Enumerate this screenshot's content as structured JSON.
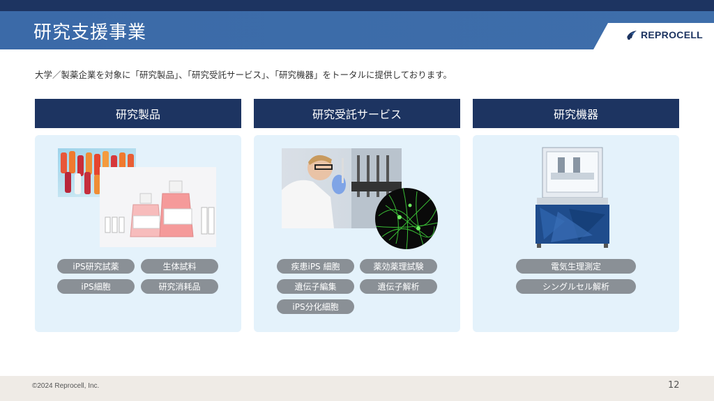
{
  "header": {
    "title": "研究支援事業",
    "logo_text": "REPROCELL",
    "logo_icon": "reprocell-bird-logo"
  },
  "intro": "大学／製薬企業を対象に「研究製品」、「研究受託サービス」、「研究機器」をトータルに提供しております。",
  "columns": [
    {
      "title": "研究製品",
      "tags": [
        "iPS研究試薬",
        "生体試料",
        "iPS細胞",
        "研究消耗品"
      ]
    },
    {
      "title": "研究受託サービス",
      "tags": [
        "疾患iPS 細胞",
        "薬効薬理試験",
        "遺伝子編集",
        "遺伝子解析",
        "iPS分化細胞"
      ]
    },
    {
      "title": "研究機器",
      "tags": [
        "電気生理測定",
        "シングルセル解析"
      ]
    }
  ],
  "footer": {
    "copyright": "©2024 Reprocell, Inc.",
    "page_number": "12"
  },
  "colors": {
    "navy": "#1d3461",
    "title_blue": "#3b6aa8",
    "panel_bg": "#e4f2fb",
    "pill_gray": "#8a9096"
  }
}
